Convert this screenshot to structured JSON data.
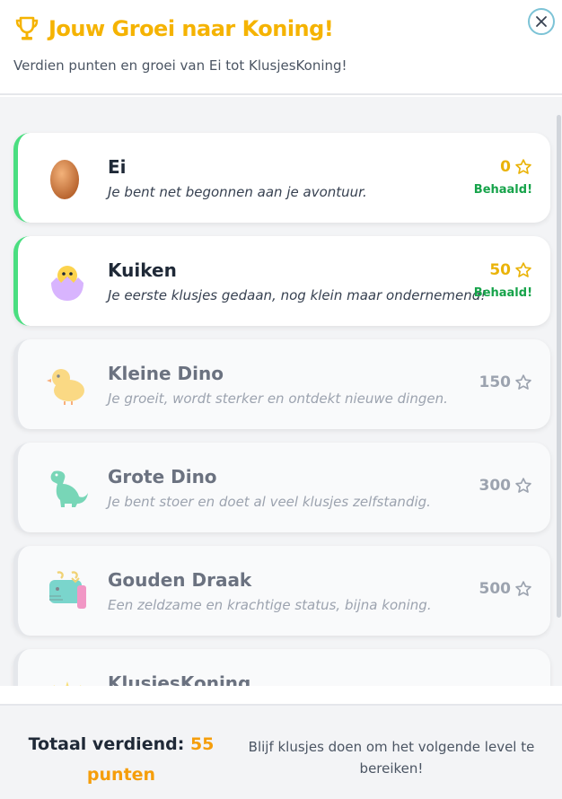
{
  "header": {
    "title": "Jouw Groei naar Koning!",
    "subtitle": "Verdien punten en groei van Ei tot KlusjesKoning!",
    "icon": "trophy-icon",
    "close_icon": "close-icon"
  },
  "levels": [
    {
      "name": "Ei",
      "description": "Je bent net begonnen aan je avontuur.",
      "points": "0",
      "status": "Behaald!",
      "icon": "egg-icon"
    },
    {
      "name": "Kuiken",
      "description": "Je eerste klusjes gedaan, nog klein maar ondernemend!",
      "points": "50",
      "status": "Behaald!",
      "icon": "hatching-chick-icon"
    },
    {
      "name": "Kleine Dino",
      "description": "Je groeit, wordt sterker en ontdekt nieuwe dingen.",
      "points": "150",
      "status": "",
      "icon": "baby-chick-icon"
    },
    {
      "name": "Grote Dino",
      "description": "Je bent stoer en doet al veel klusjes zelfstandig.",
      "points": "300",
      "status": "",
      "icon": "dinosaur-icon"
    },
    {
      "name": "Gouden Draak",
      "description": "Een zeldzame en krachtige status, bijna koning.",
      "points": "500",
      "status": "",
      "icon": "dragon-icon"
    },
    {
      "name": "KlusjesKoning",
      "description": "",
      "points": "",
      "status": "",
      "icon": "crown-icon"
    }
  ],
  "footer": {
    "total_label": "Totaal verdiend:",
    "total_value": "55",
    "total_unit": "punten",
    "hint": "Blijf klusjes doen om het volgende level te bereiken!"
  },
  "colors": {
    "accent": "#f5b301",
    "achieved_border": "#4ade80",
    "achieved_text": "#16a34a",
    "points_orange": "#f59e0b"
  }
}
